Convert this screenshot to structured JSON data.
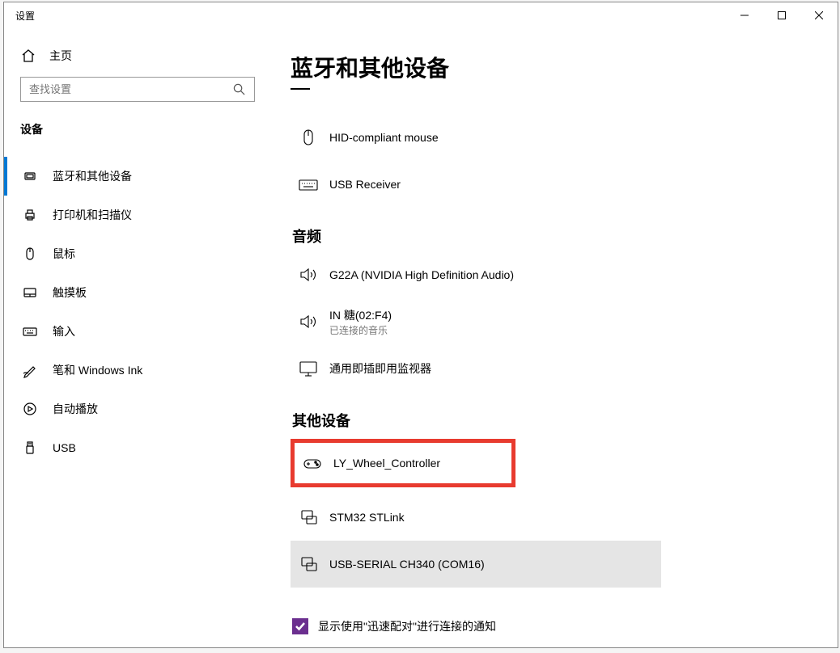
{
  "window": {
    "title": "设置"
  },
  "home": {
    "label": "主页"
  },
  "search": {
    "placeholder": "查找设置"
  },
  "section_title": "设备",
  "sidebar": {
    "items": [
      {
        "label": "蓝牙和其他设备"
      },
      {
        "label": "打印机和扫描仪"
      },
      {
        "label": "鼠标"
      },
      {
        "label": "触摸板"
      },
      {
        "label": "输入"
      },
      {
        "label": "笔和 Windows Ink"
      },
      {
        "label": "自动播放"
      },
      {
        "label": "USB"
      }
    ]
  },
  "page_title": "蓝牙和其他设备",
  "input_devices": [
    {
      "name": "HID-compliant mouse"
    },
    {
      "name": "USB Receiver"
    }
  ],
  "audio_section": "音频",
  "audio_devices": [
    {
      "name": "G22A (NVIDIA High Definition Audio)"
    },
    {
      "name": "IN 糖(02:F4)",
      "sub": "已连接的音乐"
    },
    {
      "name": "通用即插即用监视器"
    }
  ],
  "other_section": "其他设备",
  "other_devices": [
    {
      "name": "LY_Wheel_Controller"
    },
    {
      "name": "STM32 STLink"
    },
    {
      "name": "USB-SERIAL CH340 (COM16)"
    }
  ],
  "checkbox_label": "显示使用\"迅速配对\"进行连接的通知"
}
